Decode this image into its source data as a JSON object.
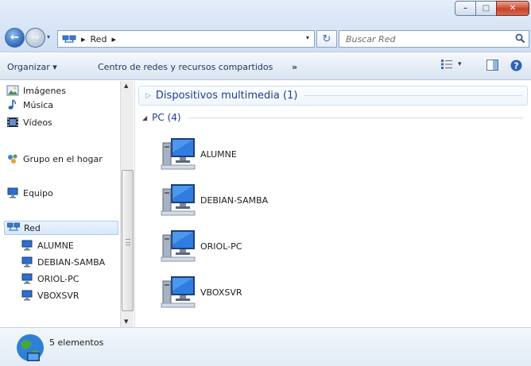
{
  "window": {
    "caption_buttons": {
      "minimize": "–",
      "maximize": "□",
      "close": "✕"
    }
  },
  "address_bar": {
    "location_icon": "network-icon",
    "separator1": "▸",
    "crumb": "Red",
    "separator2": "▸",
    "dropdown": "▾"
  },
  "nav_buttons": {
    "back": "←",
    "forward": "→",
    "history_dropdown": "▾"
  },
  "refresh_label": "↻",
  "search": {
    "placeholder": "Buscar Red",
    "icon": "magnifier-icon"
  },
  "command_bar": {
    "organize": "Organizar ▾",
    "network_center": "Centro de redes y recursos compartidos",
    "more": "»",
    "view_dropdown": "▾"
  },
  "nav_pane": {
    "items": [
      {
        "label": "Imágenes",
        "icon": "pictures-icon"
      },
      {
        "label": "Música",
        "icon": "music-icon"
      },
      {
        "label": "Vídeos",
        "icon": "videos-icon"
      },
      {
        "label": "Grupo en el hogar",
        "icon": "homegroup-icon"
      },
      {
        "label": "Equipo",
        "icon": "computer-icon"
      },
      {
        "label": "Red",
        "icon": "network-icon"
      },
      {
        "label": "ALUMNE",
        "icon": "computer-icon"
      },
      {
        "label": "DEBIAN-SAMBA",
        "icon": "computer-icon"
      },
      {
        "label": "ORIOL-PC",
        "icon": "computer-icon"
      },
      {
        "label": "VBOXSVR",
        "icon": "computer-icon"
      }
    ],
    "selected": "Red"
  },
  "content": {
    "groups": [
      {
        "title": "Dispositivos multimedia (1)",
        "expanded": false,
        "collapse_glyph": "▷"
      },
      {
        "title": "PC (4)",
        "expanded": true,
        "expand_glyph": "◢"
      }
    ],
    "computers": [
      {
        "name": "ALUMNE"
      },
      {
        "name": "DEBIAN-SAMBA"
      },
      {
        "name": "ORIOL-PC"
      },
      {
        "name": "VBOXSVR"
      }
    ]
  },
  "status_bar": {
    "text": "5 elementos",
    "icon": "network-globe-icon"
  },
  "colors": {
    "accent": "#1e3f8f",
    "selection": "#d7e8fb",
    "chrome": "#d9e6f7"
  }
}
